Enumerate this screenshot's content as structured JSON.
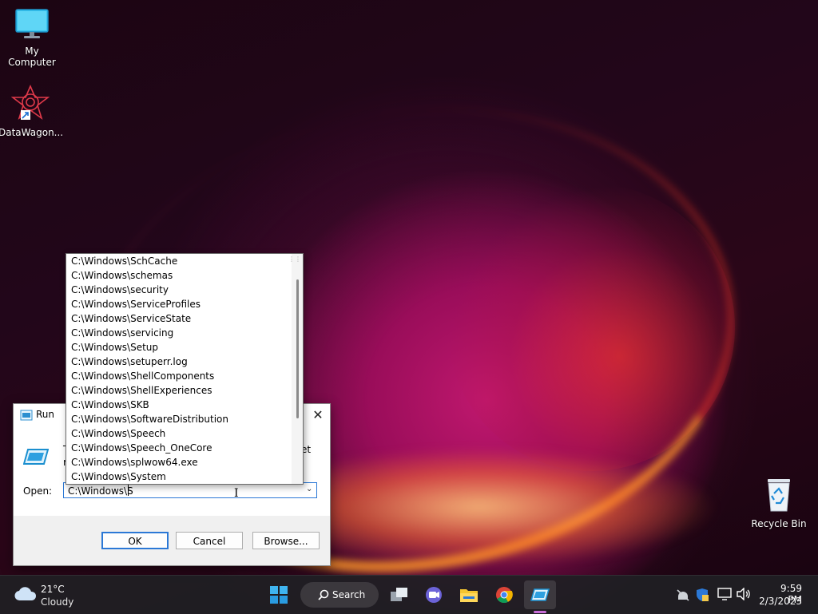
{
  "desktop": {
    "icons": [
      {
        "label": "My Computer",
        "icon": "computer-icon"
      },
      {
        "label": "DataWagon...",
        "icon": "datawagon-icon"
      },
      {
        "label": "Recycle Bin",
        "icon": "recycle-bin-icon"
      }
    ]
  },
  "run_dialog": {
    "title": "Run",
    "close_glyph": "✕",
    "description_fragment_a": "T",
    "description_fragment_b": "r",
    "description_fragment_c": "et",
    "open_label": "Open:",
    "open_value": "C:\\Windows\\S",
    "buttons": {
      "ok": "OK",
      "cancel": "Cancel",
      "browse": "Browse..."
    }
  },
  "autocomplete": {
    "items": [
      "C:\\Windows\\SchCache",
      "C:\\Windows\\schemas",
      "C:\\Windows\\security",
      "C:\\Windows\\ServiceProfiles",
      "C:\\Windows\\ServiceState",
      "C:\\Windows\\servicing",
      "C:\\Windows\\Setup",
      "C:\\Windows\\setuperr.log",
      "C:\\Windows\\ShellComponents",
      "C:\\Windows\\ShellExperiences",
      "C:\\Windows\\SKB",
      "C:\\Windows\\SoftwareDistribution",
      "C:\\Windows\\Speech",
      "C:\\Windows\\Speech_OneCore",
      "C:\\Windows\\splwow64.exe",
      "C:\\Windows\\System"
    ]
  },
  "taskbar": {
    "weather": {
      "temp": "21°C",
      "condition": "Cloudy"
    },
    "search_label": "Search",
    "apps": [
      "start-icon",
      "search-icon",
      "task-view-icon",
      "chat-icon",
      "file-explorer-icon",
      "chrome-icon",
      "run-app-icon"
    ],
    "tray_icons": [
      "network-off-icon",
      "security-icon",
      "display-icon",
      "volume-icon"
    ],
    "time": "9:59 PM",
    "date": "2/3/2023"
  },
  "colors": {
    "accent": "#2b78d6",
    "taskbar": "#202024",
    "active_indicator": "#c66bd6"
  }
}
